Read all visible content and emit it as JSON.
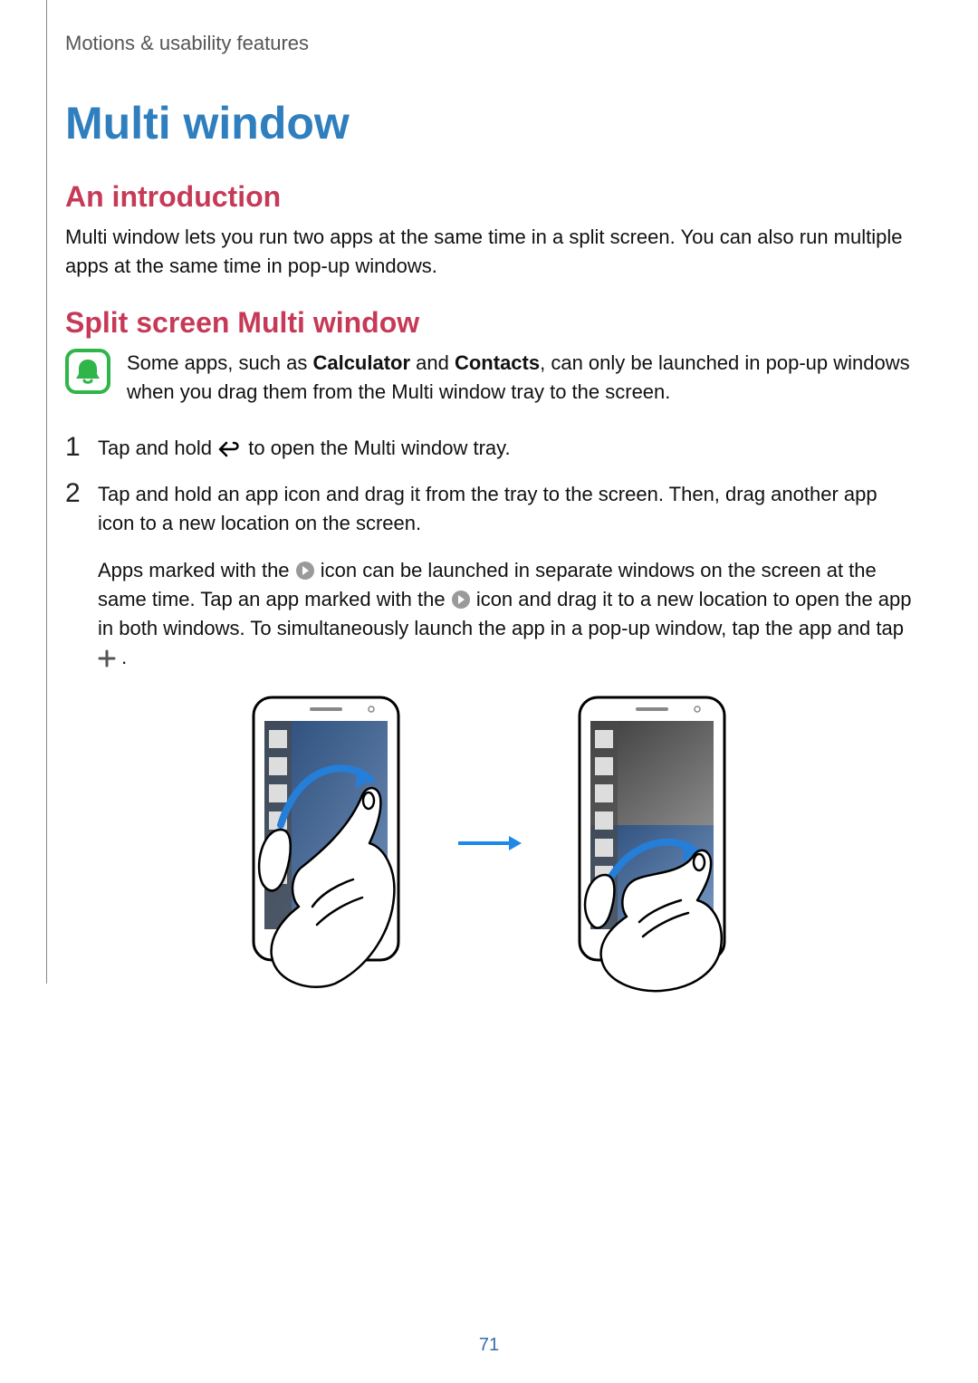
{
  "header": {
    "breadcrumb": "Motions & usability features"
  },
  "title": "Multi window",
  "section1": {
    "heading": "An introduction",
    "paragraph": "Multi window lets you run two apps at the same time in a split screen. You can also run multiple apps at the same time in pop-up windows."
  },
  "section2": {
    "heading": "Split screen Multi window",
    "note": {
      "before_bold1": "Some apps, such as ",
      "bold1": "Calculator",
      "mid": " and ",
      "bold2": "Contacts",
      "after": ", can only be launched in pop-up windows when you drag them from the Multi window tray to the screen."
    },
    "steps": [
      {
        "num": "1",
        "text_a": "Tap and hold ",
        "text_b": " to open the Multi window tray."
      },
      {
        "num": "2",
        "text": "Tap and hold an app icon and drag it from the tray to the screen. Then, drag another app icon to a new location on the screen."
      }
    ],
    "extra": {
      "t1": "Apps marked with the ",
      "t2": " icon can be launched in separate windows on the screen at the same time. Tap an app marked with the ",
      "t3": " icon and drag it to a new location to open the app in both windows. To simultaneously launch the app in a pop-up window, tap the app and tap ",
      "t4": "."
    }
  },
  "pageNumber": "71",
  "icons": {
    "bell": "bell-icon",
    "back": "back-arrow-icon",
    "multi": "multi-launch-icon",
    "plus": "plus-icon"
  }
}
